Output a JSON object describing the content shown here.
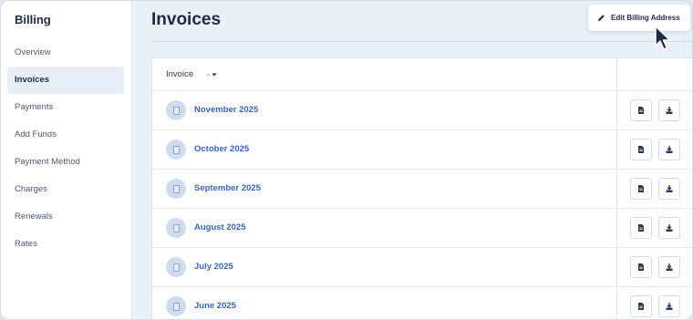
{
  "sidebar": {
    "title": "Billing",
    "items": [
      {
        "label": "Overview",
        "active": false
      },
      {
        "label": "Invoices",
        "active": true
      },
      {
        "label": "Payments",
        "active": false
      },
      {
        "label": "Add Funds",
        "active": false
      },
      {
        "label": "Payment Method",
        "active": false
      },
      {
        "label": "Charges",
        "active": false
      },
      {
        "label": "Renewals",
        "active": false
      },
      {
        "label": "Rates",
        "active": false
      }
    ]
  },
  "header": {
    "title": "Invoices",
    "edit_button_label": "Edit Billing Address",
    "edit_button_icon": "pencil-icon"
  },
  "table": {
    "column_header": "Invoice",
    "sort_icon": "sort-icon",
    "rows": [
      {
        "label": "November 2025"
      },
      {
        "label": "October 2025"
      },
      {
        "label": "September 2025"
      },
      {
        "label": "August 2025"
      },
      {
        "label": "July 2025"
      },
      {
        "label": "June 2025"
      }
    ],
    "row_actions": [
      "view-document-icon",
      "download-icon"
    ]
  },
  "colors": {
    "accent_link": "#3c64b4",
    "heading": "#1f2a44",
    "active_nav_bg": "#e8eef8",
    "page_bg": "#eaf0f8"
  }
}
